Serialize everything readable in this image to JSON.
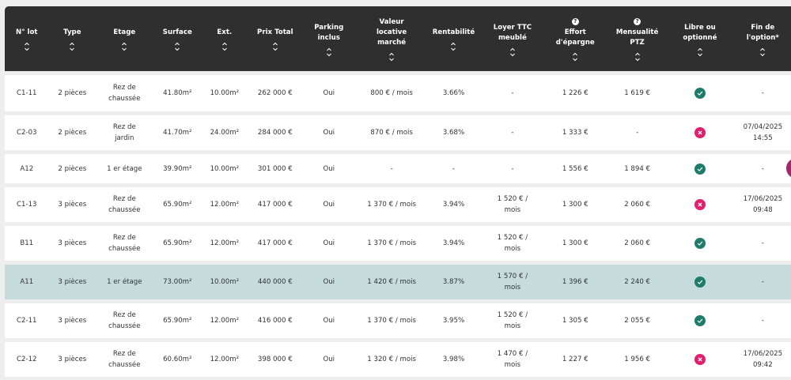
{
  "colors": {
    "header_bg": "#2f2f2f",
    "row_highlight": "#c6dbdb",
    "available": "#1e7d6a",
    "optioned": "#e0206f",
    "fab": "#a3266e"
  },
  "columns": [
    {
      "key": "lot",
      "lines": [
        "N° lot"
      ],
      "info": false
    },
    {
      "key": "type",
      "lines": [
        "Type"
      ],
      "info": false
    },
    {
      "key": "etage",
      "lines": [
        "Etage"
      ],
      "info": false
    },
    {
      "key": "surface",
      "lines": [
        "Surface"
      ],
      "info": false
    },
    {
      "key": "ext",
      "lines": [
        "Ext."
      ],
      "info": false
    },
    {
      "key": "prix",
      "lines": [
        "Prix Total"
      ],
      "info": false
    },
    {
      "key": "parking",
      "lines": [
        "Parking",
        "inclus"
      ],
      "info": false
    },
    {
      "key": "valeur",
      "lines": [
        "Valeur",
        "locative",
        "marché"
      ],
      "info": false
    },
    {
      "key": "rentabilite",
      "lines": [
        "Rentabilité"
      ],
      "info": false
    },
    {
      "key": "loyer",
      "lines": [
        "Loyer TTC",
        "meublé"
      ],
      "info": false
    },
    {
      "key": "effort",
      "lines": [
        "Effort",
        "d'épargne"
      ],
      "info": true
    },
    {
      "key": "mensualite",
      "lines": [
        "Mensualité",
        "PTZ"
      ],
      "info": true
    },
    {
      "key": "libre",
      "lines": [
        "Libre ou",
        "optionné"
      ],
      "info": false
    },
    {
      "key": "fin",
      "lines": [
        "Fin de",
        "l'option*"
      ],
      "info": false
    }
  ],
  "info_icon_glyph": "?",
  "rows": [
    {
      "lot": "C1-11",
      "type": "2 pièces",
      "etage": [
        "Rez de",
        "chaussée"
      ],
      "surface": "41.80m²",
      "ext": "10.00m²",
      "prix": "262 000 €",
      "parking": "Oui",
      "valeur": [
        "800 € / mois"
      ],
      "rentabilite": "3.66%",
      "loyer": [
        "-"
      ],
      "effort": "1 226 €",
      "mensualite": "1 619 €",
      "libre": "available",
      "fin": [
        "-"
      ],
      "highlight": false
    },
    {
      "lot": "C2-03",
      "type": "2 pièces",
      "etage": [
        "Rez de",
        "jardin"
      ],
      "surface": "41.70m²",
      "ext": "24.00m²",
      "prix": "284 000 €",
      "parking": "Oui",
      "valeur": [
        "870 € / mois"
      ],
      "rentabilite": "3.68%",
      "loyer": [
        "-"
      ],
      "effort": "1 333 €",
      "mensualite": "-",
      "libre": "optioned",
      "fin": [
        "07/04/2025",
        "14:55"
      ],
      "highlight": false
    },
    {
      "lot": "A12",
      "type": "2 pièces",
      "etage": [
        "1 er étage"
      ],
      "surface": "39.90m²",
      "ext": "10.00m²",
      "prix": "301 000 €",
      "parking": "Oui",
      "valeur": [
        "-"
      ],
      "rentabilite": "-",
      "loyer": [
        "-"
      ],
      "effort": "1 556 €",
      "mensualite": "1 894 €",
      "libre": "available",
      "fin": [
        "-"
      ],
      "highlight": false
    },
    {
      "lot": "C1-13",
      "type": "3 pièces",
      "etage": [
        "Rez de",
        "chaussée"
      ],
      "surface": "65.90m²",
      "ext": "12.00m²",
      "prix": "417 000 €",
      "parking": "Oui",
      "valeur": [
        "1 370 € / mois"
      ],
      "rentabilite": "3.94%",
      "loyer": [
        "1 520 € /",
        "mois"
      ],
      "effort": "1 300 €",
      "mensualite": "2 060 €",
      "libre": "optioned",
      "fin": [
        "17/06/2025",
        "09:48"
      ],
      "highlight": false
    },
    {
      "lot": "B11",
      "type": "3 pièces",
      "etage": [
        "Rez de",
        "chaussée"
      ],
      "surface": "65.90m²",
      "ext": "12.00m²",
      "prix": "417 000 €",
      "parking": "Oui",
      "valeur": [
        "1 370 € / mois"
      ],
      "rentabilite": "3.94%",
      "loyer": [
        "1 520 € /",
        "mois"
      ],
      "effort": "1 300 €",
      "mensualite": "2 060 €",
      "libre": "available",
      "fin": [
        "-"
      ],
      "highlight": false
    },
    {
      "lot": "A11",
      "type": "3 pièces",
      "etage": [
        "1 er étage"
      ],
      "surface": "73.00m²",
      "ext": "10.00m²",
      "prix": "440 000 €",
      "parking": "Oui",
      "valeur": [
        "1 420 € / mois"
      ],
      "rentabilite": "3.87%",
      "loyer": [
        "1 570 € /",
        "mois"
      ],
      "effort": "1 396 €",
      "mensualite": "2 240 €",
      "libre": "available",
      "fin": [
        "-"
      ],
      "highlight": true
    },
    {
      "lot": "C2-11",
      "type": "3 pièces",
      "etage": [
        "Rez de",
        "chaussée"
      ],
      "surface": "65.90m²",
      "ext": "12.00m²",
      "prix": "416 000 €",
      "parking": "Oui",
      "valeur": [
        "1 370 € / mois"
      ],
      "rentabilite": "3.95%",
      "loyer": [
        "1 520 € /",
        "mois"
      ],
      "effort": "1 305 €",
      "mensualite": "2 055 €",
      "libre": "available",
      "fin": [
        "-"
      ],
      "highlight": false
    },
    {
      "lot": "C2-12",
      "type": "3 pièces",
      "etage": [
        "Rez de",
        "chaussée"
      ],
      "surface": "60.60m²",
      "ext": "12.00m²",
      "prix": "398 000 €",
      "parking": "Oui",
      "valeur": [
        "1 320 € / mois"
      ],
      "rentabilite": "3.98%",
      "loyer": [
        "1 470 € /",
        "mois"
      ],
      "effort": "1 227 €",
      "mensualite": "1 956 €",
      "libre": "optioned",
      "fin": [
        "17/06/2025",
        "09:42"
      ],
      "highlight": false
    }
  ]
}
